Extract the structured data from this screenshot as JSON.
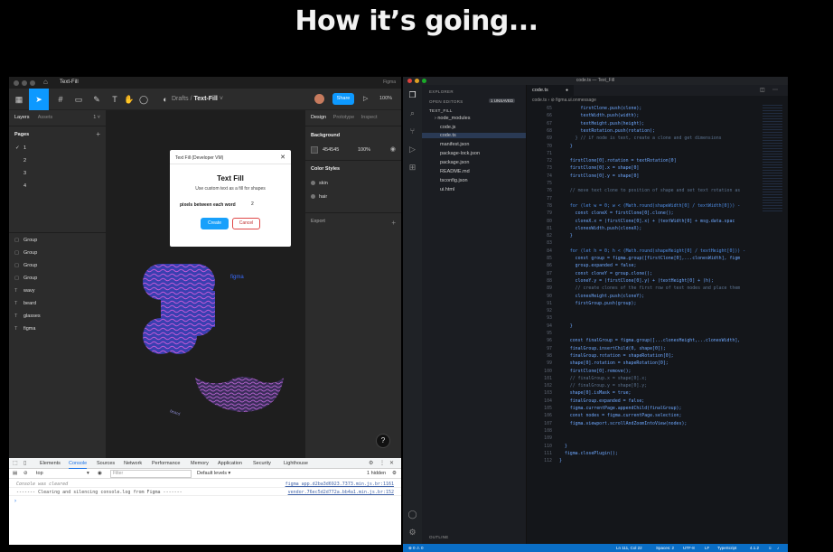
{
  "slide": {
    "title": "How it’s going..."
  },
  "figma": {
    "titlebar": {
      "tab": "Text-Fill",
      "app": "Figma"
    },
    "toolbar": {
      "breadcrumb_folder": "Drafts",
      "breadcrumb_sep": "/",
      "breadcrumb_file": "Text-Fill",
      "share_label": "Share",
      "zoom": "100%"
    },
    "left_panel": {
      "tab_layers": "Layers",
      "tab_assets": "Assets",
      "page_switch": "1 ˅",
      "pages_heading": "Pages",
      "pages": [
        "1",
        "2",
        "3",
        "4"
      ],
      "layers": [
        {
          "icon": "▢",
          "name": "Group"
        },
        {
          "icon": "▢",
          "name": "Group"
        },
        {
          "icon": "▢",
          "name": "Group"
        },
        {
          "icon": "▢",
          "name": "Group"
        },
        {
          "icon": "T",
          "name": "wavy"
        },
        {
          "icon": "T",
          "name": "beard"
        },
        {
          "icon": "T",
          "name": "glasses"
        },
        {
          "icon": "T",
          "name": "figma"
        }
      ]
    },
    "dialog": {
      "header": "Text Fill (Developer VM)",
      "title": "Text Fill",
      "description": "Use custom text as a fill for shapes",
      "field_label": "pixels between each word",
      "field_value": "2",
      "create_label": "Create",
      "cancel_label": "Cancel"
    },
    "canvas": {
      "figma_text": "figma",
      "beard_text": "beard"
    },
    "right_panel": {
      "tab_design": "Design",
      "tab_prototype": "Prototype",
      "tab_inspect": "Inspect",
      "background_heading": "Background",
      "bg_hex": "454545",
      "bg_opacity": "100%",
      "color_styles_heading": "Color Styles",
      "styles": [
        "skin",
        "hair"
      ],
      "export_heading": "Export"
    },
    "devtools": {
      "tabs": [
        "Elements",
        "Console",
        "Sources",
        "Network",
        "Performance",
        "Memory",
        "Application",
        "Security",
        "Lighthouse"
      ],
      "active_tab": "Console",
      "context": "top",
      "filter_placeholder": "Filter",
      "levels": "Default levels ▾",
      "hidden": "1 hidden",
      "rows": [
        {
          "text": "Console was cleared",
          "src": "figma_app.d2ba3d6923.7373.min.js.br:1161"
        },
        {
          "text": "------- Clearing and silencing console.log from Figma -------",
          "src": "vendor.76ec5d2d772a.bb4a1.min.js.br:152"
        }
      ],
      "prompt": "›"
    }
  },
  "vscode": {
    "title": "code.ts — Text_Fill",
    "explorer_heading": "EXPLORER",
    "open_editors": "OPEN EDITORS",
    "unsaved": "1 UNSAVED",
    "project": "TEXT_FILL",
    "files": [
      "node_modules",
      "code.js",
      "code.ts",
      "manifest.json",
      "package-lock.json",
      "package.json",
      "README.md",
      "tsconfig.json",
      "ui.html"
    ],
    "outline": "OUTLINE",
    "tab": "code.ts",
    "tab_dot": "●",
    "breadcrumb": "code.ts › ⊘ figma.ui.onmessage",
    "code_lines": [
      {
        "n": "65",
        "t": "        firstClone.push(clone);",
        "k": ""
      },
      {
        "n": "66",
        "t": "        textWidth.push(width);",
        "k": ""
      },
      {
        "n": "67",
        "t": "        textHeight.push(height);",
        "k": ""
      },
      {
        "n": "68",
        "t": "        textRotation.push(rotation);",
        "k": ""
      },
      {
        "n": "69",
        "t": "      } // if node is text, create a clone and get dimensions",
        "k": "cm"
      },
      {
        "n": "70",
        "t": "    }",
        "k": ""
      },
      {
        "n": "71",
        "t": "",
        "k": ""
      },
      {
        "n": "72",
        "t": "    firstClone[0].rotation = textRotation[0]",
        "k": ""
      },
      {
        "n": "73",
        "t": "    firstClone[0].x = shape[0]",
        "k": ""
      },
      {
        "n": "74",
        "t": "    firstClone[0].y = shape[0]",
        "k": ""
      },
      {
        "n": "75",
        "t": "",
        "k": ""
      },
      {
        "n": "76",
        "t": "    // move text clone to position of shape and set text rotation as",
        "k": "cm"
      },
      {
        "n": "77",
        "t": "",
        "k": ""
      },
      {
        "n": "78",
        "t": "    for (let w = 0; w < (Math.round(shapeWidth[0] / textWidth[0])) -",
        "k": "kw"
      },
      {
        "n": "79",
        "t": "      const cloneX = firstClone[0].clone();",
        "k": ""
      },
      {
        "n": "80",
        "t": "      cloneX.x = (firstClone[0].x) + (textWidth[0] + msg.data.spac",
        "k": ""
      },
      {
        "n": "81",
        "t": "      clonesWidth.push(cloneX);",
        "k": ""
      },
      {
        "n": "82",
        "t": "    }",
        "k": ""
      },
      {
        "n": "83",
        "t": "",
        "k": ""
      },
      {
        "n": "84",
        "t": "    for (let h = 0; h < (Math.round(shapeHeight[0] / textHeight[0])) -",
        "k": "kw"
      },
      {
        "n": "85",
        "t": "      const group = figma.group([firstClone[0],...clonesWidth], figm",
        "k": ""
      },
      {
        "n": "86",
        "t": "      group.expanded = false;",
        "k": ""
      },
      {
        "n": "87",
        "t": "      const cloneY = group.clone();",
        "k": ""
      },
      {
        "n": "88",
        "t": "      cloneY.y = (firstClone[0].y) + (textHeight[0] + (h);",
        "k": ""
      },
      {
        "n": "89",
        "t": "      // create clones of the first row of text nodes and place them",
        "k": "cm"
      },
      {
        "n": "90",
        "t": "      clonesHeight.push(cloneY);",
        "k": ""
      },
      {
        "n": "91",
        "t": "      firstGroup.push(group);",
        "k": ""
      },
      {
        "n": "92",
        "t": "",
        "k": ""
      },
      {
        "n": "93",
        "t": "",
        "k": ""
      },
      {
        "n": "94",
        "t": "    }",
        "k": ""
      },
      {
        "n": "95",
        "t": "",
        "k": ""
      },
      {
        "n": "96",
        "t": "    const finalGroup = figma.group([...clonesHeight,...clonesWidth],",
        "k": ""
      },
      {
        "n": "97",
        "t": "    finalGroup.insertChild(0, shape[0]);",
        "k": ""
      },
      {
        "n": "98",
        "t": "    finalGroup.rotation = shapeRotation[0];",
        "k": ""
      },
      {
        "n": "99",
        "t": "    shape[0].rotation = shapeRotation[0];",
        "k": ""
      },
      {
        "n": "100",
        "t": "    firstClone[0].remove();",
        "k": ""
      },
      {
        "n": "101",
        "t": "    // finalGroup.x = shape[0].x;",
        "k": "cm"
      },
      {
        "n": "102",
        "t": "    // finalGroup.y = shape[0].y;",
        "k": "cm"
      },
      {
        "n": "103",
        "t": "    shape[0].isMask = true;",
        "k": ""
      },
      {
        "n": "104",
        "t": "    finalGroup.expanded = false;",
        "k": ""
      },
      {
        "n": "105",
        "t": "    figma.currentPage.appendChild(finalGroup);",
        "k": ""
      },
      {
        "n": "106",
        "t": "    const nodes = figma.currentPage.selection;",
        "k": ""
      },
      {
        "n": "107",
        "t": "    figma.viewport.scrollAndZoomIntoView(nodes);",
        "k": ""
      },
      {
        "n": "108",
        "t": "",
        "k": ""
      },
      {
        "n": "109",
        "t": "",
        "k": ""
      },
      {
        "n": "110",
        "t": "  }",
        "k": ""
      },
      {
        "n": "111",
        "t": "  figma.closePlugin();",
        "k": ""
      },
      {
        "n": "112",
        "t": "}",
        "k": ""
      }
    ],
    "status": {
      "left": "⊗ 0 ⚠ 0",
      "position": "Ln 111, Col 22",
      "spaces": "Spaces: 2",
      "encoding": "UTF-8",
      "eol": "LF",
      "language": "TypeScript",
      "version": "4.1.2"
    }
  }
}
